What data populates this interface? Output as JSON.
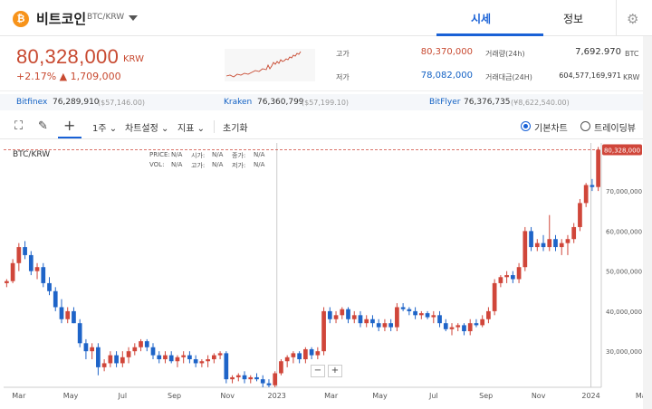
{
  "header": {
    "coin_symbol": "₿",
    "coin_name": "비트코인",
    "pair": "BTC/KRW",
    "tabs": [
      "시세",
      "정보"
    ],
    "settings_icon": "gear-icon"
  },
  "summary": {
    "price": "80,328,000",
    "unit": "KRW",
    "change": "+2.17% ▲ 1,709,000",
    "high_label": "고가",
    "high_value": "80,370,000",
    "low_label": "저가",
    "low_value": "78,082,000",
    "volume_label": "거래량(24h)",
    "volume_value": "7,692.970",
    "volume_unit": "BTC",
    "amount_label": "거래대금(24H)",
    "amount_value": "604,577,169,971",
    "amount_unit": "KRW"
  },
  "exchanges": [
    {
      "name": "Bitfinex",
      "price": "76,289,910",
      "sub": "($57,146.00)"
    },
    {
      "name": "Kraken",
      "price": "76,360,799",
      "sub": "($57,199.10)"
    },
    {
      "name": "BitFlyer",
      "price": "76,376,735",
      "sub": "(¥8,622,540.00)"
    }
  ],
  "toolbar": {
    "fullscreen_icon": "fullscreen-icon",
    "draw_icon": "pencil-icon",
    "crosshair_icon": "crosshair-icon",
    "period": "1주",
    "chart_settings": "차트설정",
    "indicators": "지표",
    "reset": "초기화",
    "mode_basic": "기본차트",
    "mode_trading": "트레이딩뷰"
  },
  "chart_info": {
    "pair": "BTC/KRW",
    "price_label": "PRICE:",
    "price_val": "N/A",
    "open_label": "시가:",
    "open_val": "N/A",
    "close_label": "종가:",
    "close_val": "N/A",
    "vol_label": "VOL:",
    "vol_val": "N/A",
    "high_label": "고가:",
    "high_val": "N/A",
    "low_label": "저가:",
    "low_val": "N/A"
  },
  "zoom": {
    "minus": "−",
    "plus": "+"
  },
  "chart_data": {
    "type": "candlestick",
    "current_price_label": "80,328,000",
    "y_ticks": [
      "70,000,000",
      "60,000,000",
      "50,000,000",
      "40,000,000",
      "30,000,000"
    ],
    "y_tick_values": [
      70000000,
      60000000,
      50000000,
      40000000,
      30000000
    ],
    "x_ticks": [
      "Mar",
      "May",
      "Jul",
      "Sep",
      "Nov",
      "2023",
      "Mar",
      "May",
      "Jul",
      "Sep",
      "Nov",
      "2024",
      "Ma"
    ],
    "x_tick_positions": [
      2.0,
      10.5,
      19.0,
      27.5,
      36.2,
      44.3,
      53.2,
      61.2,
      70.0,
      78.6,
      87.2,
      95.8,
      104.0
    ],
    "ylim": [
      21000000,
      82000000
    ],
    "candles": [
      [
        47,
        48,
        46,
        47.5
      ],
      [
        47.5,
        53,
        47,
        52
      ],
      [
        52,
        57,
        50,
        56
      ],
      [
        56,
        57.5,
        53,
        54
      ],
      [
        54,
        55,
        49,
        50
      ],
      [
        50,
        52,
        48,
        51
      ],
      [
        51,
        52,
        46,
        47
      ],
      [
        47,
        48.5,
        44,
        45
      ],
      [
        45,
        46,
        40,
        41
      ],
      [
        41,
        43,
        37,
        38
      ],
      [
        38,
        41,
        37,
        40
      ],
      [
        40,
        41,
        37,
        37
      ],
      [
        37,
        38,
        31,
        32
      ],
      [
        32,
        33,
        28,
        30
      ],
      [
        30,
        32,
        28,
        31
      ],
      [
        31,
        32,
        24,
        26
      ],
      [
        26,
        28,
        25,
        27
      ],
      [
        27,
        30,
        26,
        29
      ],
      [
        29,
        30,
        26,
        27
      ],
      [
        27,
        30,
        26,
        28.5
      ],
      [
        28.5,
        31,
        27,
        30
      ],
      [
        30,
        32,
        29,
        31
      ],
      [
        31,
        33,
        30,
        32.5
      ],
      [
        32.5,
        33,
        30,
        31
      ],
      [
        31,
        32,
        28,
        29
      ],
      [
        29,
        30,
        27,
        28
      ],
      [
        28,
        30,
        27,
        29
      ],
      [
        29,
        30,
        27,
        27.5
      ],
      [
        27.5,
        29,
        26,
        28.5
      ],
      [
        28.5,
        30,
        27,
        29
      ],
      [
        29,
        30,
        27,
        28
      ],
      [
        28,
        29,
        26,
        27
      ],
      [
        27,
        28,
        26,
        27.5
      ],
      [
        27.5,
        29,
        26,
        28
      ],
      [
        28,
        29.5,
        27,
        29
      ],
      [
        29,
        30,
        28,
        29.5
      ],
      [
        29.5,
        30,
        22,
        23
      ],
      [
        23,
        24,
        22,
        23.5
      ],
      [
        23.5,
        24.5,
        22.5,
        24
      ],
      [
        24,
        25,
        22,
        23
      ],
      [
        23,
        24,
        22,
        23.5
      ],
      [
        23.5,
        24.5,
        22.5,
        23
      ],
      [
        23,
        24,
        21,
        22
      ],
      [
        22,
        23,
        21,
        21.5
      ],
      [
        21.5,
        25,
        21,
        24.5
      ],
      [
        24.5,
        28,
        24,
        27.5
      ],
      [
        27.5,
        29,
        26,
        28.5
      ],
      [
        28.5,
        30,
        27,
        29.5
      ],
      [
        29.5,
        30,
        27,
        28
      ],
      [
        28,
        31,
        27,
        30.5
      ],
      [
        30.5,
        31,
        28,
        29
      ],
      [
        29,
        31,
        28,
        30
      ],
      [
        30,
        41,
        29,
        40
      ],
      [
        40,
        41,
        37,
        38
      ],
      [
        38,
        40,
        37,
        39
      ],
      [
        39,
        41,
        38,
        40.5
      ],
      [
        40.5,
        41,
        37,
        38
      ],
      [
        38,
        40,
        37,
        39
      ],
      [
        39,
        40,
        36,
        37
      ],
      [
        37,
        39,
        36,
        38
      ],
      [
        38,
        39,
        36,
        37
      ],
      [
        37,
        38,
        35,
        36
      ],
      [
        36,
        38,
        35,
        37
      ],
      [
        37,
        38,
        35,
        36
      ],
      [
        36,
        42,
        35,
        41
      ],
      [
        41,
        42,
        40,
        40.5
      ],
      [
        40.5,
        41,
        39,
        40
      ],
      [
        40,
        41,
        38,
        39
      ],
      [
        39,
        40,
        38,
        39.5
      ],
      [
        39.5,
        40,
        38,
        38.5
      ],
      [
        38.5,
        40,
        37,
        39
      ],
      [
        39,
        40,
        36,
        37
      ],
      [
        37,
        38,
        35,
        35.5
      ],
      [
        35.5,
        37,
        34,
        36
      ],
      [
        36,
        37,
        35,
        36.5
      ],
      [
        36.5,
        37,
        34,
        35
      ],
      [
        35,
        38,
        34,
        37
      ],
      [
        37,
        38,
        36,
        36.5
      ],
      [
        36.5,
        39,
        36,
        38
      ],
      [
        38,
        41,
        37,
        40
      ],
      [
        40,
        48,
        39,
        47
      ],
      [
        47,
        49,
        46,
        48.5
      ],
      [
        48.5,
        50,
        47,
        49
      ],
      [
        49,
        50,
        47,
        48
      ],
      [
        48,
        52,
        47,
        51
      ],
      [
        51,
        61,
        50,
        60
      ],
      [
        60,
        61,
        55,
        56
      ],
      [
        56,
        58,
        55,
        57
      ],
      [
        57,
        59,
        55,
        56
      ],
      [
        56,
        64,
        55,
        58
      ],
      [
        58,
        59,
        55,
        56
      ],
      [
        56,
        58,
        54,
        57
      ],
      [
        57,
        59,
        54,
        58
      ],
      [
        58,
        62,
        57,
        61
      ],
      [
        61,
        68,
        60,
        67
      ],
      [
        67,
        72,
        66,
        71.5
      ],
      [
        71.5,
        73,
        70,
        71
      ],
      [
        71,
        81,
        70,
        80.3
      ]
    ]
  }
}
